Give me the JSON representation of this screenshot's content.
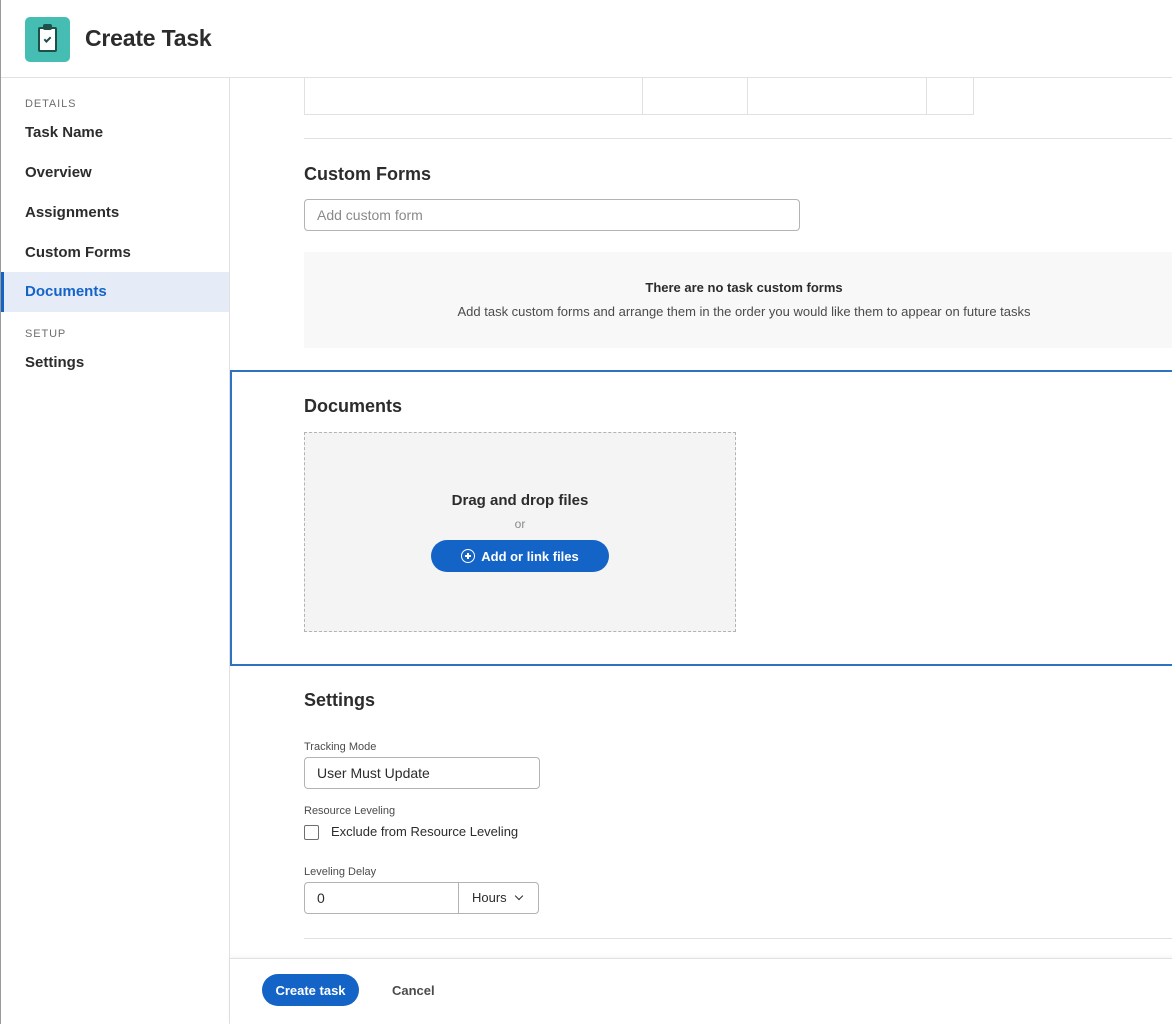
{
  "header": {
    "title": "Create Task",
    "icon": "clipboard-check-icon",
    "icon_color": "#45bdb3"
  },
  "sidebar": {
    "details_heading": "DETAILS",
    "setup_heading": "SETUP",
    "items": [
      {
        "label": "Task Name"
      },
      {
        "label": "Overview"
      },
      {
        "label": "Assignments"
      },
      {
        "label": "Custom Forms"
      },
      {
        "label": "Documents",
        "active": true
      },
      {
        "label": "Settings"
      }
    ]
  },
  "custom_forms": {
    "title": "Custom Forms",
    "input_placeholder": "Add custom form",
    "empty_title": "There are no task custom forms",
    "empty_message": "Add task custom forms and arrange them in the order you would like them to appear on future tasks"
  },
  "documents": {
    "title": "Documents",
    "drop_title": "Drag and drop files",
    "drop_or": "or",
    "add_button": "Add or link files"
  },
  "settings": {
    "title": "Settings",
    "tracking_mode_label": "Tracking Mode",
    "tracking_mode_value": "User Must Update",
    "resource_leveling_label": "Resource Leveling",
    "exclude_label": "Exclude from Resource Leveling",
    "exclude_checked": false,
    "leveling_delay_label": "Leveling Delay",
    "leveling_delay_value": "0",
    "leveling_delay_unit": "Hours"
  },
  "footer": {
    "create_button": "Create task",
    "cancel_button": "Cancel"
  },
  "colors": {
    "accent": "#1464c8",
    "active_nav_bg": "#e5ecf8",
    "section_highlight": "#2d73c2"
  }
}
